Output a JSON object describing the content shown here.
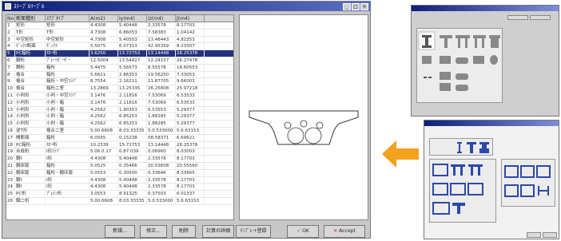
{
  "main_window": {
    "title": "ｽﾃｰﾌﾞﾙﾘｰﾌﾞﾙ",
    "title_buttons": [
      "_",
      "□",
      "×"
    ],
    "columns": [
      "No",
      "断面種別",
      "ｽﾗﾌﾞﾀｲﾌﾟ",
      "A(m2)",
      "Iy(m4)",
      "Iz(m4)",
      "J(m4)"
    ],
    "rows": [
      [
        "1",
        "矩形",
        "矩形",
        "4.4308",
        "5.40448",
        "2.33578",
        "8.17703"
      ],
      [
        "2",
        "T形",
        "T形",
        "4.7308",
        "6.86053",
        "7.58383",
        "1.04142"
      ],
      [
        "3",
        "中空矩形",
        "中空矩形",
        "4.7308",
        "5.40503",
        "13.48443",
        "4.82353"
      ],
      [
        "4",
        "ﾎﾞｯｸｽ断面",
        "ﾎﾞｯｸｽ",
        "5.5075",
        "6.07313",
        "42.95359",
        "8.23307"
      ],
      [
        "5",
        "PC箱桁",
        "ﾎﾛｰ桁",
        "3.6250",
        "13.72753",
        "13.14448",
        "28.25378"
      ],
      [
        "6",
        "鋼桁",
        "ﾌﾟﾚｰﾄｶﾞｰﾀﾞｰ",
        "12.5004",
        "13.54427",
        "12.24157",
        "26.27478"
      ],
      [
        "7",
        "鋼桁",
        "箱桁",
        "5.4475",
        "5.56573",
        "8.55578",
        "18.60553"
      ],
      [
        "8",
        "複合",
        "箱桁",
        "5.6621",
        "2.86353",
        "19.56250",
        "7.33053"
      ],
      [
        "9",
        "複合",
        "箱桁・中空ｽﾗﾌﾞ",
        "8.7554",
        "2.16211",
        "11.87705",
        "9.66003"
      ],
      [
        "10",
        "複合",
        "箱桁二室",
        "13.2869",
        "13.25335",
        "26.25808",
        "25.97218"
      ],
      [
        "11",
        "小判形",
        "小判・中空ｽﾗﾌﾞ",
        "3.1476",
        "2.11816",
        "7.53069",
        "6.53533"
      ],
      [
        "12",
        "小判形",
        "小判・箱",
        "3.1476",
        "2.11816",
        "7.53069",
        "6.53533"
      ],
      [
        "13",
        "小判形",
        "小判・箱",
        "4.2562",
        "1.90353",
        "6.53553",
        "5.29377"
      ],
      [
        "14",
        "小判形",
        "小判・箱",
        "4.2562",
        "6.85253",
        "1.88285",
        "5.29377"
      ],
      [
        "15",
        "小判形",
        "小判・箱",
        "4.2562",
        "6.85253",
        "1.88285",
        "5.29377"
      ],
      [
        "16",
        "逆T形",
        "複合二室",
        "5.00.6608",
        "8.03.33335",
        "5.0.533000",
        "5.6.63153"
      ],
      [
        "17",
        "開断面",
        "箱桁",
        "6.0565",
        "0.15238",
        "58.58371",
        "6.69621"
      ],
      [
        "18",
        "PC箱桁",
        "ﾎﾛｰ桁",
        "10.2339",
        "15.72753",
        "13.14448",
        "28.25378"
      ],
      [
        "19",
        "合成桁",
        "I形ｽﾗﾌﾞ",
        "5.06.0.17",
        "0.87.039",
        "0.06960",
        "8.03003"
      ],
      [
        "20",
        "鋼I",
        "I形",
        "4.4308",
        "5.40448",
        "2.33578",
        "8.17703"
      ],
      [
        "21",
        "鋼床版",
        "箱桁",
        "5.0525",
        "0.35466",
        "20.53608",
        "20.55560"
      ],
      [
        "22",
        "鋼床版",
        "箱桁・鋼床版",
        "5.0553",
        "0.30500",
        "0.33646",
        "8.33665"
      ],
      [
        "23",
        "鋼I",
        "I形",
        "4.4308",
        "5.40448",
        "2.33578",
        "8.17703"
      ],
      [
        "24",
        "鋼I",
        "I形",
        "4.4308",
        "5.40448",
        "2.33578",
        "8.17703"
      ],
      [
        "25",
        "PC桁",
        "ﾌﾟﾚﾃﾝ桁",
        "3.0553",
        "8.91325",
        "0.37503",
        "6.01337"
      ],
      [
        "26",
        "鋼二桁",
        "",
        "5.00.6608",
        "8.03.33335",
        "5.0.533000",
        "5.6.63153"
      ]
    ],
    "selected_row": 4,
    "buttons": [
      "新規...",
      "修正...",
      "削除",
      "計算の詳細",
      "ﾃﾝﾌﾟﾚｰﾄ登録",
      "OK",
      "Accept"
    ],
    "ok_icon": "check-icon",
    "accept_icon": "x-icon"
  },
  "colors": {
    "title_bar": "#0d1f7a",
    "selection": "#23327e",
    "arrow": "#f2a21c",
    "accept_x": "#c81e1e"
  },
  "dialog_top": {
    "title": ""
  },
  "dialog_bottom": {
    "title": "",
    "tab_labels": [
      "",
      ""
    ],
    "footer_buttons": [
      "",
      ""
    ]
  },
  "icons": {
    "arrow": "left-arrow-icon"
  }
}
